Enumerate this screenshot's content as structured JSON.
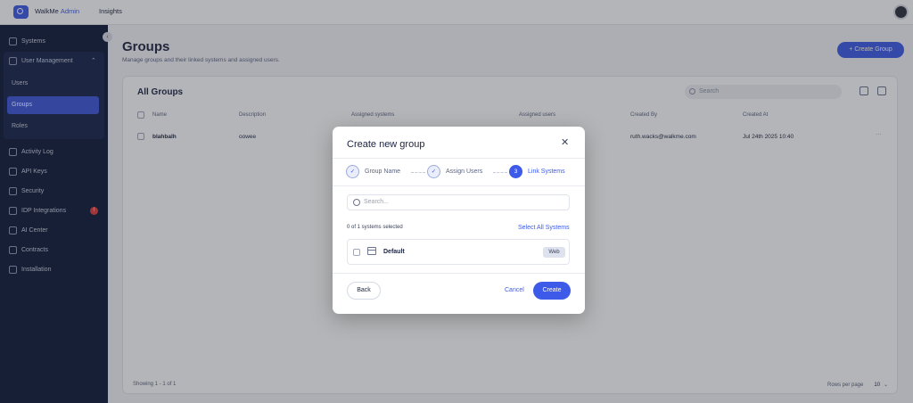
{
  "topbar": {
    "brand": "WalkMe",
    "brand_suffix": "Admin",
    "nav_insights": "Insights"
  },
  "sidebar": {
    "items": [
      {
        "label": "Systems",
        "icon": "grid-icon"
      },
      {
        "label": "User Management",
        "icon": "users-icon"
      },
      {
        "label": "Activity Log",
        "icon": "activity-icon"
      },
      {
        "label": "API Keys",
        "icon": "key-icon"
      },
      {
        "label": "Security",
        "icon": "shield-icon"
      },
      {
        "label": "IDP Integrations",
        "icon": "idp-icon",
        "badge": "!"
      },
      {
        "label": "AI Center",
        "icon": "ai-icon"
      },
      {
        "label": "Contracts",
        "icon": "contract-icon"
      },
      {
        "label": "Installation",
        "icon": "gear-icon"
      }
    ],
    "user_management_sub": [
      "Users",
      "Groups",
      "Roles"
    ],
    "active_sub": "Groups"
  },
  "page": {
    "title": "Groups",
    "subtitle": "Manage groups and their linked systems and assigned users.",
    "create_button": "Create Group"
  },
  "card": {
    "title": "All Groups",
    "search_placeholder": "Search",
    "columns": [
      "Name",
      "Description",
      "Assigned systems",
      "Assigned users",
      "Created By",
      "Created At"
    ],
    "rows": [
      {
        "name": "blahbalh",
        "description": "oowee",
        "created_by": "ruth.wacks@walkme.com",
        "created_at": "Jul 24th 2025 10:40",
        "menu": "···"
      }
    ],
    "footer_showing": "Showing 1 - 1 of 1",
    "rows_per_page_label": "Rows per page",
    "rows_per_page_value": "10"
  },
  "modal": {
    "title": "Create new group",
    "close": "✕",
    "steps": [
      {
        "label": "Group Name",
        "state": "done",
        "marker": "✓"
      },
      {
        "label": "Assign Users",
        "state": "done",
        "marker": "✓"
      },
      {
        "label": "Link Systems",
        "state": "active",
        "marker": "3"
      }
    ],
    "search_placeholder": "Search...",
    "selected_count": "0 of 1 systems selected",
    "select_all": "Select All Systems",
    "systems": [
      {
        "name": "Default",
        "type": "Web"
      }
    ],
    "back": "Back",
    "cancel": "Cancel",
    "create": "Create"
  },
  "colors": {
    "accent": "#3d5ae8",
    "sidebar_bg": "#0f1a38",
    "badge": "#e03c3c"
  }
}
